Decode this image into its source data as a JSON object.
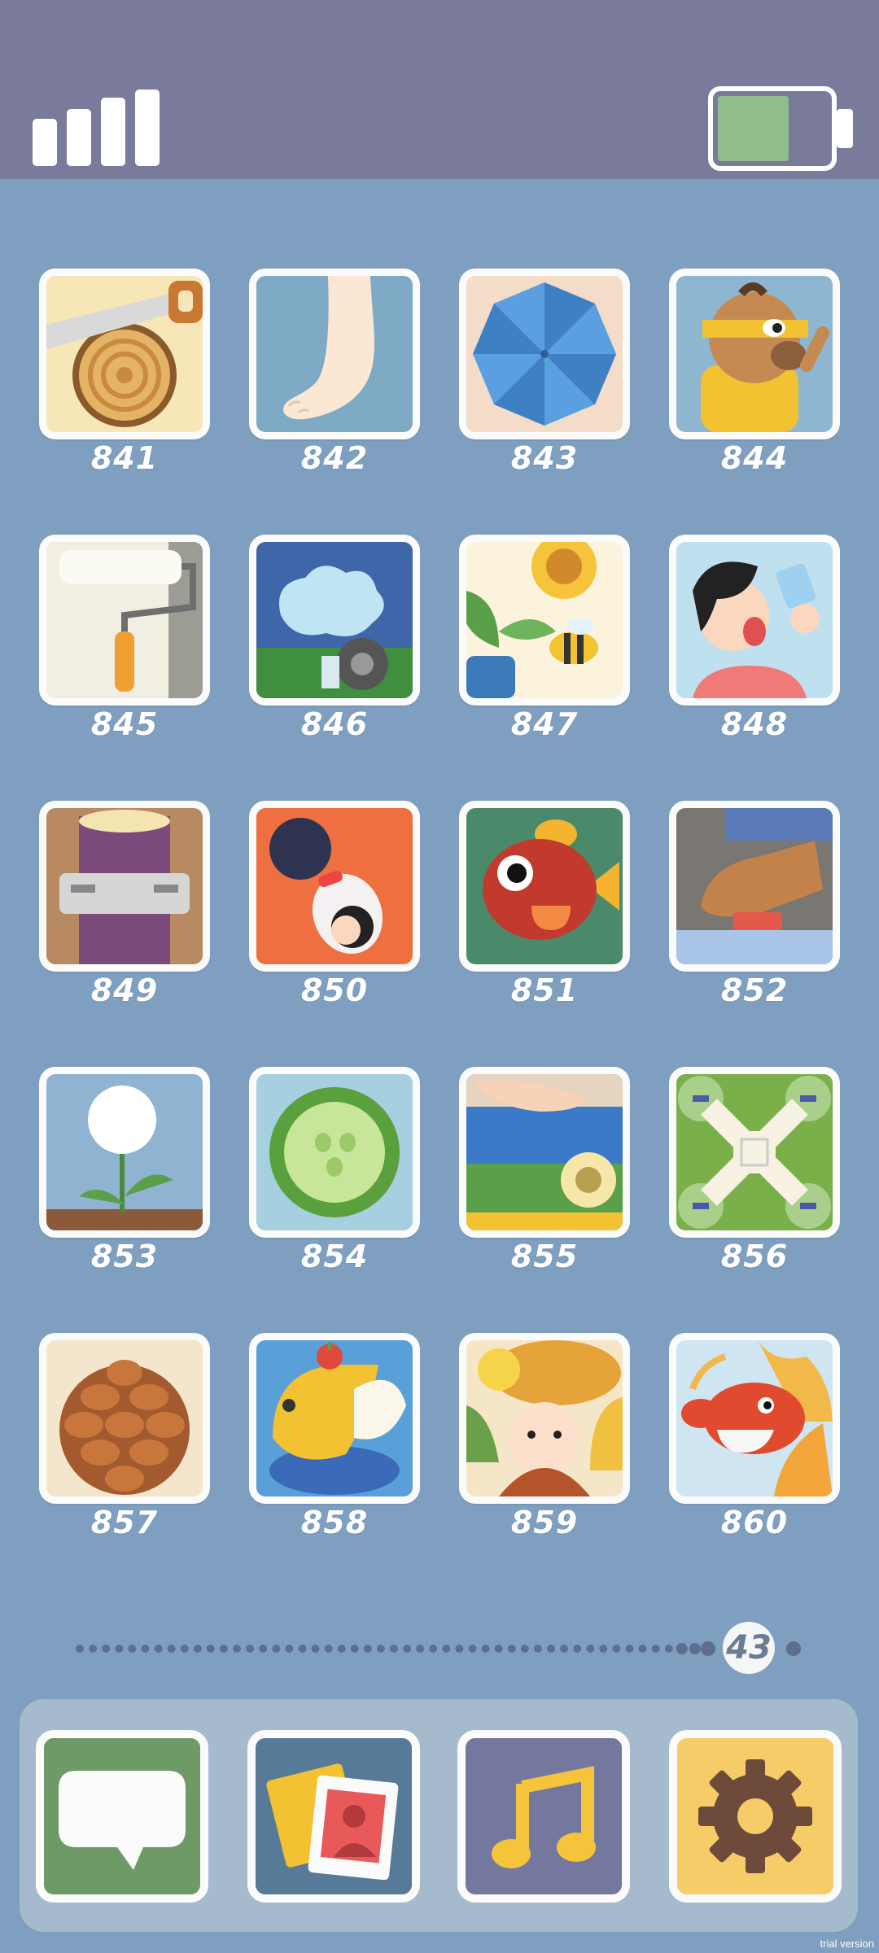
{
  "status": {
    "signal_icon": "signal-bars-icon",
    "battery_icon": "battery-icon",
    "battery_level": 0.65,
    "battery_color": "#8fbe8c"
  },
  "levels": [
    {
      "number": "841",
      "icon": "saw-and-log-icon"
    },
    {
      "number": "842",
      "icon": "foot-icon"
    },
    {
      "number": "843",
      "icon": "umbrella-icon"
    },
    {
      "number": "844",
      "icon": "masked-bird-hero-icon"
    },
    {
      "number": "845",
      "icon": "paint-roller-icon"
    },
    {
      "number": "846",
      "icon": "car-hydrant-splash-icon"
    },
    {
      "number": "847",
      "icon": "sunflower-bee-icon"
    },
    {
      "number": "848",
      "icon": "boy-drinking-water-icon"
    },
    {
      "number": "849",
      "icon": "lock-on-log-icon"
    },
    {
      "number": "850",
      "icon": "person-with-ball-icon"
    },
    {
      "number": "851",
      "icon": "red-fish-icon"
    },
    {
      "number": "852",
      "icon": "shoe-on-pedal-icon"
    },
    {
      "number": "853",
      "icon": "dandelion-icon"
    },
    {
      "number": "854",
      "icon": "cucumber-slice-icon"
    },
    {
      "number": "855",
      "icon": "hand-cutting-banana-icon"
    },
    {
      "number": "856",
      "icon": "drone-icon"
    },
    {
      "number": "857",
      "icon": "pine-cone-icon"
    },
    {
      "number": "858",
      "icon": "lemon-squeezer-icon"
    },
    {
      "number": "859",
      "icon": "autumn-girl-icon"
    },
    {
      "number": "860",
      "icon": "dragon-icon"
    }
  ],
  "pager": {
    "current_page": "43",
    "dot_count_before": 49,
    "dot_count_after": 1
  },
  "dock": [
    {
      "name": "messages",
      "icon": "speech-bubble-icon",
      "color": "#6e9a66"
    },
    {
      "name": "photos",
      "icon": "photo-cards-icon",
      "color": "#577a99"
    },
    {
      "name": "music",
      "icon": "music-note-icon",
      "color": "#74789e"
    },
    {
      "name": "settings",
      "icon": "gear-icon",
      "color": "#f6cc68"
    }
  ],
  "watermark": "trial version"
}
